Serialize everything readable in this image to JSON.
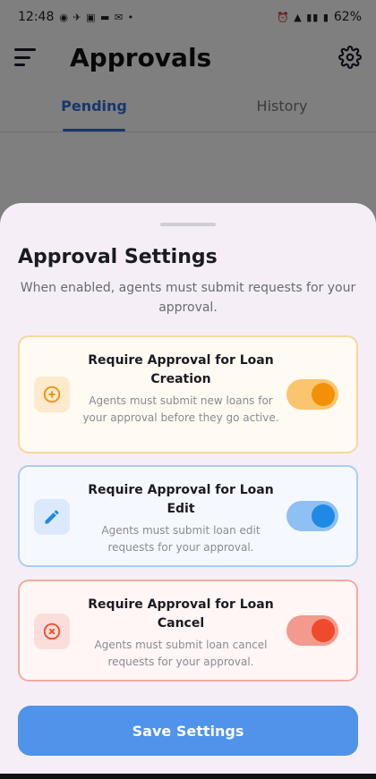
{
  "status_bar": {
    "time": "12:48",
    "left_icons": "◉ ✈ ▣ ▬ ✉ •",
    "right_icons": "⏰ ▲ ▮▮ ▮",
    "battery": "62%"
  },
  "header": {
    "title": "Approvals",
    "menu_icon": "menu-icon",
    "settings_icon": "gear-icon"
  },
  "tabs": [
    {
      "label": "Pending",
      "active": true
    },
    {
      "label": "History",
      "active": false
    }
  ],
  "sheet": {
    "title": "Approval Settings",
    "subtitle": "When enabled, agents must submit requests for your approval.",
    "cards": [
      {
        "title": "Require Approval for Loan Creation",
        "description": "Agents must submit new loans for your approval before they go active.",
        "icon": "add-circle-icon",
        "enabled": true,
        "color": "#f29107"
      },
      {
        "title": "Require Approval for Loan Edit",
        "description": "Agents must submit loan edit requests for your approval.",
        "icon": "pencil-icon",
        "enabled": true,
        "color": "#1f8ae6"
      },
      {
        "title": "Require Approval for Loan Cancel",
        "description": "Agents must submit loan cancel requests for your approval.",
        "icon": "cancel-circle-icon",
        "enabled": true,
        "color": "#ef4a2c"
      }
    ],
    "save_label": "Save Settings"
  }
}
